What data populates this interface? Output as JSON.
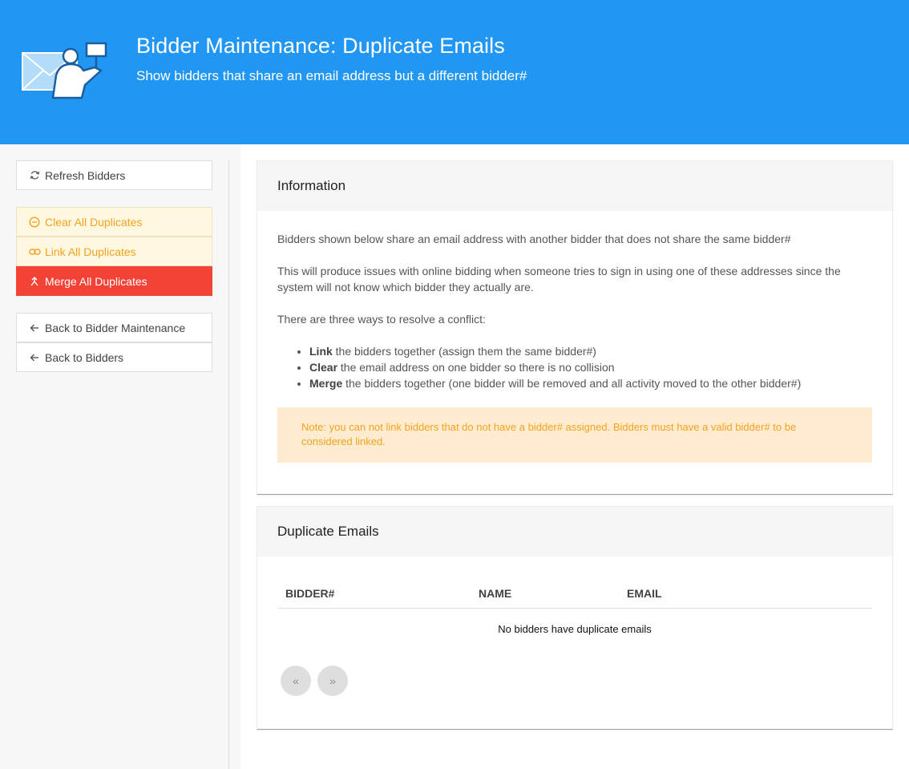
{
  "header": {
    "title": "Bidder Maintenance: Duplicate Emails",
    "subtitle": "Show bidders that share an email address but a different bidder#"
  },
  "sidebar": {
    "refresh": "Refresh Bidders",
    "clear_all": "Clear All Duplicates",
    "link_all": "Link All Duplicates",
    "merge_all": "Merge All Duplicates",
    "back_maintenance": "Back to Bidder Maintenance",
    "back_bidders": "Back to Bidders"
  },
  "info": {
    "heading": "Information",
    "p1": "Bidders shown below share an email address with another bidder that does not share the same bidder#",
    "p2": "This will produce issues with online bidding when someone tries to sign in using one of these addresses since the system will not know which bidder they actually are.",
    "p3": "There are three ways to resolve a conflict:",
    "options": [
      {
        "term": "Link",
        "text": " the bidders together (assign them the same bidder#)"
      },
      {
        "term": "Clear",
        "text": " the email address on one bidder so there is no collision"
      },
      {
        "term": "Merge",
        "text": " the bidders together (one bidder will be removed and all activity moved to the other bidder#)"
      }
    ],
    "note": "Note: you can not link bidders that do not have a bidder# assigned. Bidders must have a valid bidder# to be considered linked."
  },
  "duplicates": {
    "heading": "Duplicate Emails",
    "columns": [
      "BIDDER#",
      "NAME",
      "EMAIL"
    ],
    "empty_message": "No bidders have duplicate emails",
    "prev": "«",
    "next": "»"
  },
  "colors": {
    "header_blue": "#2196f3",
    "warn_orange": "#f4a21d",
    "danger_red": "#f44336"
  }
}
